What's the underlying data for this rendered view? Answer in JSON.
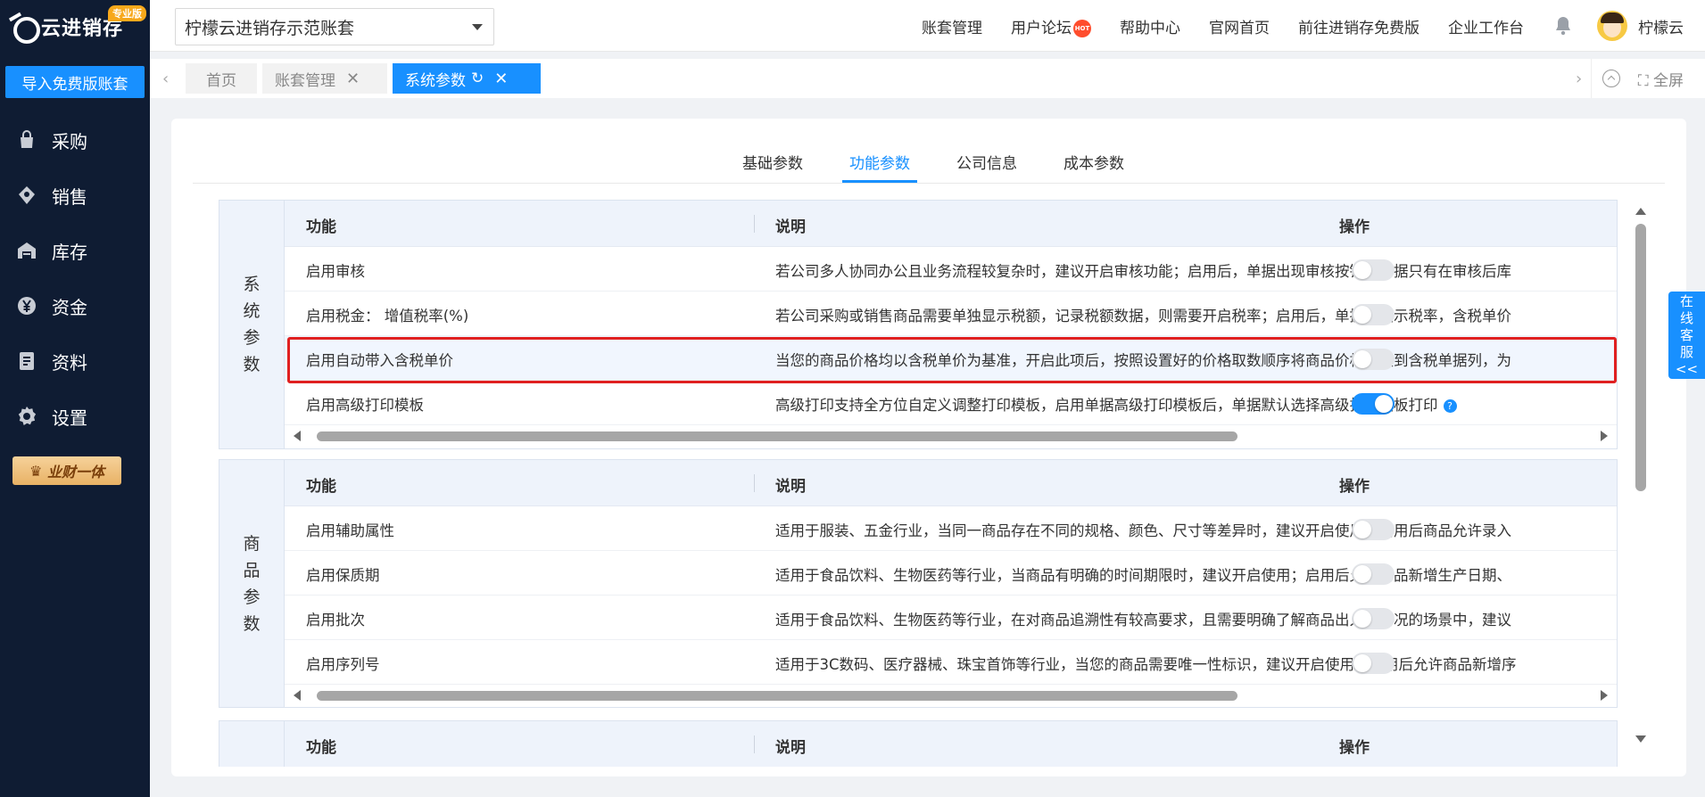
{
  "app": {
    "logo_text": "云进销存",
    "edition_badge": "专业版",
    "import_button": "导入免费版账套",
    "biz_badge": "业财一体"
  },
  "sidebar": {
    "items": [
      {
        "label": "采购",
        "icon": "bag-icon"
      },
      {
        "label": "销售",
        "icon": "sales-icon"
      },
      {
        "label": "库存",
        "icon": "warehouse-icon"
      },
      {
        "label": "资金",
        "icon": "yen-icon"
      },
      {
        "label": "资料",
        "icon": "document-icon"
      },
      {
        "label": "设置",
        "icon": "gear-icon"
      }
    ]
  },
  "header": {
    "account_select": "柠檬云进销存示范账套",
    "nav": [
      "账套管理",
      "用户论坛",
      "帮助中心",
      "官网首页",
      "前往进销存免费版",
      "企业工作台"
    ],
    "hot_badge": "HOT",
    "user_name": "柠檬云"
  },
  "tabs": {
    "items": [
      {
        "label": "首页",
        "closable": false,
        "active": false
      },
      {
        "label": "账套管理",
        "closable": true,
        "active": false
      },
      {
        "label": "系统参数",
        "closable": true,
        "active": true
      }
    ],
    "fullscreen_label": "全屏"
  },
  "subtabs": {
    "items": [
      "基础参数",
      "功能参数",
      "公司信息",
      "成本参数"
    ],
    "active_index": 1
  },
  "table_headers": {
    "function": "功能",
    "desc": "说明",
    "action": "操作"
  },
  "sections": [
    {
      "label_chars": [
        "系",
        "统",
        "参",
        "数"
      ],
      "rows": [
        {
          "func": "启用审核",
          "desc": "若公司多人协同办公且业务流程较复杂时，建议开启审核功能；启用后，单据出现审核按钮，单据只有在审核后库",
          "enabled": false
        },
        {
          "func": "启用税金： 增值税率(%)",
          "desc": "若公司采购或销售商品需要单独显示税额，记录税额数据，则需要开启税率；启用后，单据会展示税率，含税单价",
          "enabled": false
        },
        {
          "func": "启用自动带入含税单价",
          "desc": "当您的商品价格均以含税单价为基准，开启此项后，按照设置好的价格取数顺序将商品价格取数到含税单据列，为",
          "enabled": false
        },
        {
          "func": "启用高级打印模板",
          "desc": "高级打印支持全方位自定义调整打印模板，启用单据高级打印模板后，单据默认选择高级打印模板打印",
          "enabled": true,
          "help": "?"
        }
      ]
    },
    {
      "label_chars": [
        "商",
        "品",
        "参",
        "数"
      ],
      "rows": [
        {
          "func": "启用辅助属性",
          "desc": "适用于服装、五金行业，当同一商品存在不同的规格、颜色、尺寸等差异时，建议开启使用；启用后商品允许录入",
          "enabled": false
        },
        {
          "func": "启用保质期",
          "desc": "适用于食品饮料、生物医药等行业，当商品有明确的时间期限时，建议开启使用；启用后允许商品新增生产日期、",
          "enabled": false
        },
        {
          "func": "启用批次",
          "desc": "适用于食品饮料、生物医药等行业，在对商品追溯性有较高要求，且需要明确了解商品出入库情况的场景中，建议",
          "enabled": false
        },
        {
          "func": "启用序列号",
          "desc": "适用于3C数码、医疗器械、珠宝首饰等行业，当您的商品需要唯一性标识，建议开启使用；启用后允许商品新增序",
          "enabled": false
        }
      ]
    }
  ],
  "customer_service": [
    "在",
    "线",
    "客",
    "服",
    "<<"
  ],
  "colors": {
    "primary": "#1890ff",
    "sidebar": "#0f1c33",
    "highlight": "#e02020"
  }
}
